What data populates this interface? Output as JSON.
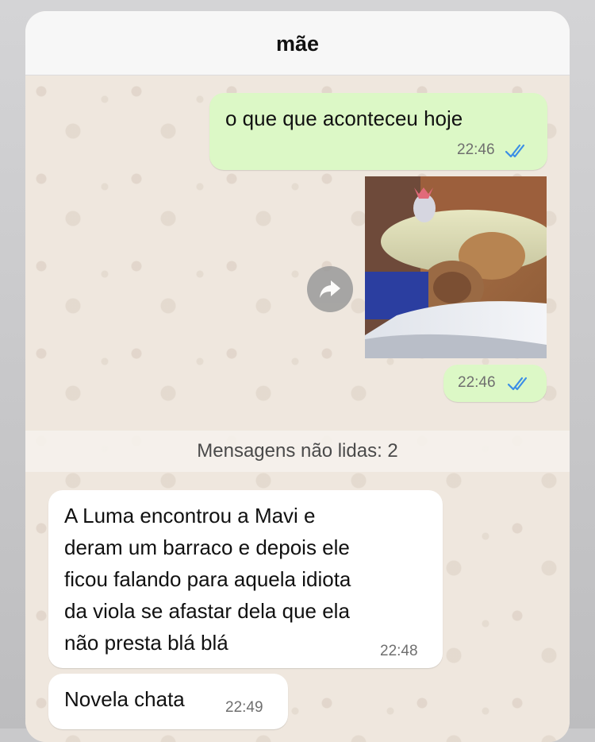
{
  "chat": {
    "title": "mãe"
  },
  "messages": [
    {
      "direction": "out",
      "text": "o que que aconteceu hoje",
      "time": "22:46",
      "status": "read"
    },
    {
      "direction": "out",
      "type": "image",
      "image_desc": "photo",
      "time": "22:46",
      "status": "read"
    },
    {
      "direction": "in",
      "lines": [
        "A Luma encontrou a Mavi e",
        "deram um barraco e depois ele",
        "ficou falando para aquela idiota",
        "da viola se afastar dela que ela",
        "não presta blá blá"
      ],
      "time": "22:48"
    },
    {
      "direction": "in",
      "text": "Novela chata",
      "time": "22:49"
    }
  ],
  "unread_divider": "Mensagens não lidas: 2",
  "icons": {
    "read_ticks": "double-check-icon",
    "forward": "forward-arrow-icon"
  },
  "colors": {
    "outgoing_bubble": "#dcf8c6",
    "incoming_bubble": "#ffffff",
    "read_ticks": "#3b8ee6",
    "wallpaper": "#efe7de"
  }
}
